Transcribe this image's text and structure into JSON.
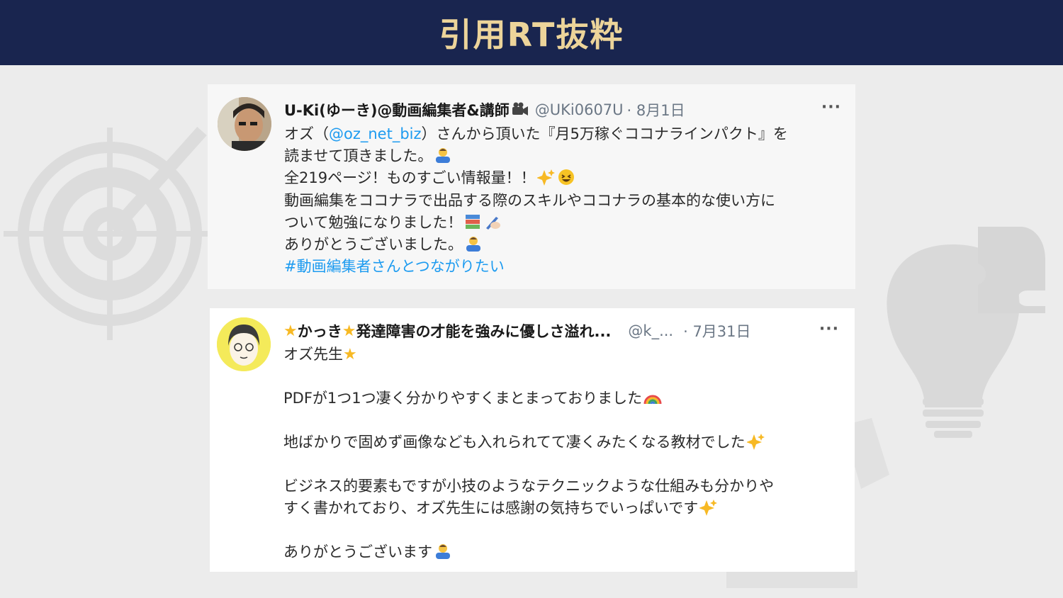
{
  "header": {
    "title": "引用RT抜粋"
  },
  "tweets": [
    {
      "name": "U-Ki(ゆーき)@動画編集者&講師",
      "handle": "@UKi0607U",
      "date": "· 8月1日",
      "more": "···",
      "lines": {
        "l1a": "オズ（",
        "l1mention": "@oz_net_biz",
        "l1b": "）さんから頂いた『月5万稼ぐココナラインパクト』を",
        "l2": "読ませて頂きました。",
        "l3": "全219ページ！ものすごい情報量！！",
        "l4": "動画編集をココナラで出品する際のスキルやココナラの基本的な使い方に",
        "l5": "ついて勉強になりました！",
        "l6": "ありがとうございました。",
        "hashtag": "#動画編集者さんとつながりたい"
      }
    },
    {
      "name_a": "かっき",
      "name_b": "発達障害の才能を強みに優しさ溢れ...",
      "handle": "@k_...",
      "date": "· 7月31日",
      "more": "···",
      "lines": {
        "l1": "オズ先生",
        "l2": "PDFが1つ1つ凄く分かりやすくまとまっておりました",
        "l3": "地ばかりで固めず画像なども入れられてて凄くみたくなる教材でした",
        "l4": "ビジネス的要素もですが小技のようなテクニックような仕組みも分かりや",
        "l5": "すく書かれており、オズ先生には感謝の気持ちでいっぱいです",
        "l6": "ありがとうございます"
      }
    }
  ],
  "icons": [
    "target-icon",
    "lightbulb-icon",
    "puzzle-icon",
    "video-camera-icon",
    "bowing-person-icon",
    "sparkles-icon",
    "grinning-face-icon",
    "books-icon",
    "writing-hand-icon",
    "rainbow-icon",
    "star-icon"
  ]
}
